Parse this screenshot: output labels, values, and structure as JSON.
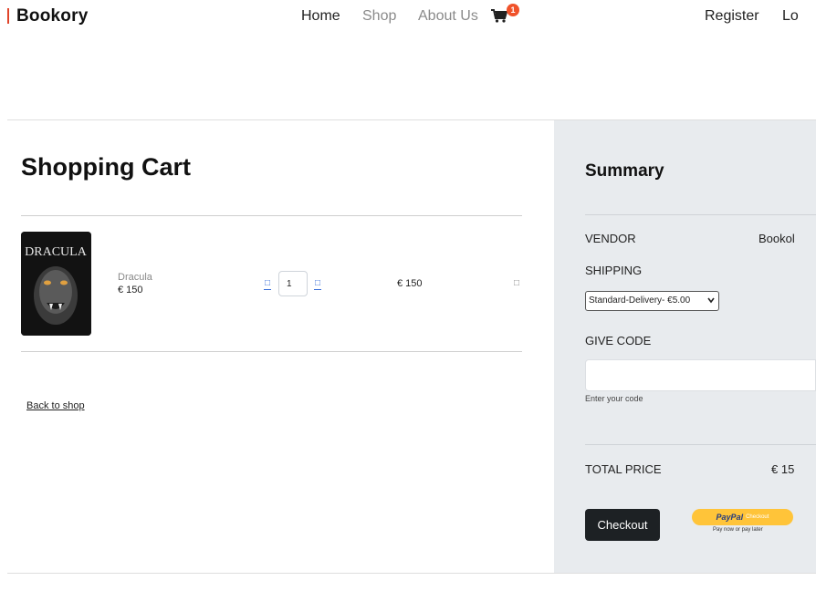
{
  "navbar": {
    "brand": "Bookory",
    "links": [
      "Home",
      "Shop",
      "About Us"
    ],
    "cart_count": "1",
    "register": "Register",
    "login": "Lo"
  },
  "cart": {
    "title": "Shopping Cart",
    "items": [
      {
        "cover_text": "DRACULA",
        "name": "Dracula",
        "price": "€ 150",
        "quantity": "1",
        "total": "€ 150"
      }
    ],
    "back_link": "Back to shop"
  },
  "summary": {
    "title": "Summary",
    "vendor_label": "VENDOR",
    "vendor_value": "Bookol",
    "shipping_label": "SHIPPING",
    "shipping_selected": "Standard-Delivery- €5.00",
    "code_label": "GIVE CODE",
    "code_help": "Enter your code",
    "total_label": "TOTAL PRICE",
    "total_value": "€ 15",
    "checkout_label": "Checkout",
    "paypal": {
      "word1": "PayPal",
      "word2": "",
      "checkout": "Checkout",
      "tagline": "Pay now or pay later"
    }
  },
  "colors": {
    "accent": "#f0522a",
    "panel": "#e8ebee",
    "button_dark": "#1d2124",
    "paypal": "#ffc439"
  }
}
